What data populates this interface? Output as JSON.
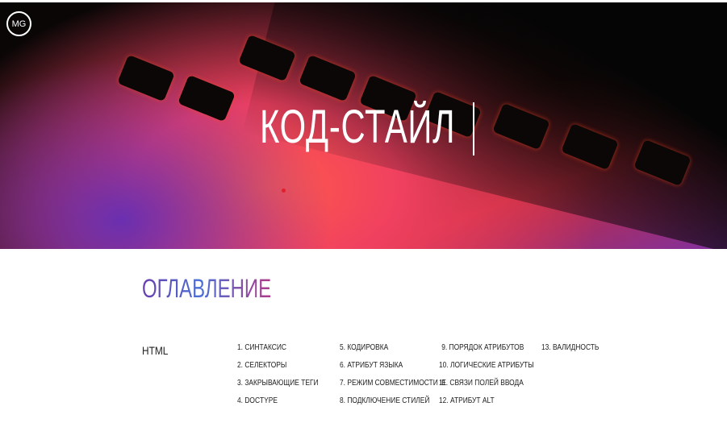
{
  "logo": "MG",
  "hero": {
    "title": "КОД-СТАЙЛ"
  },
  "toc": {
    "title": "ОГЛАВЛЕНИЕ",
    "section": "HTML",
    "columns": [
      [
        "1. СИНТАКСИС",
        "2. СЕЛЕКТОРЫ",
        "3. ЗАКРЫВАЮЩИЕ ТЕГИ",
        "4. DOCTYPE"
      ],
      [
        "5. КОДИРОВКА",
        "6. АТРИБУТ ЯЗЫКА",
        "7. РЕЖИМ СОВМЕСТИМОСТИ IE",
        "8. ПОДКЛЮЧЕНИЕ СТИЛЕЙ"
      ],
      [
        "9. ПОРЯДОК АТРИБУТОВ",
        "10. ЛОГИЧЕСКИЕ АТРИБУТЫ",
        "11. СВЯЗИ ПОЛЕЙ ВВОДА",
        "12. АТРИБУТ ALT"
      ],
      [
        "13. ВАЛИДНОСТЬ"
      ]
    ]
  }
}
